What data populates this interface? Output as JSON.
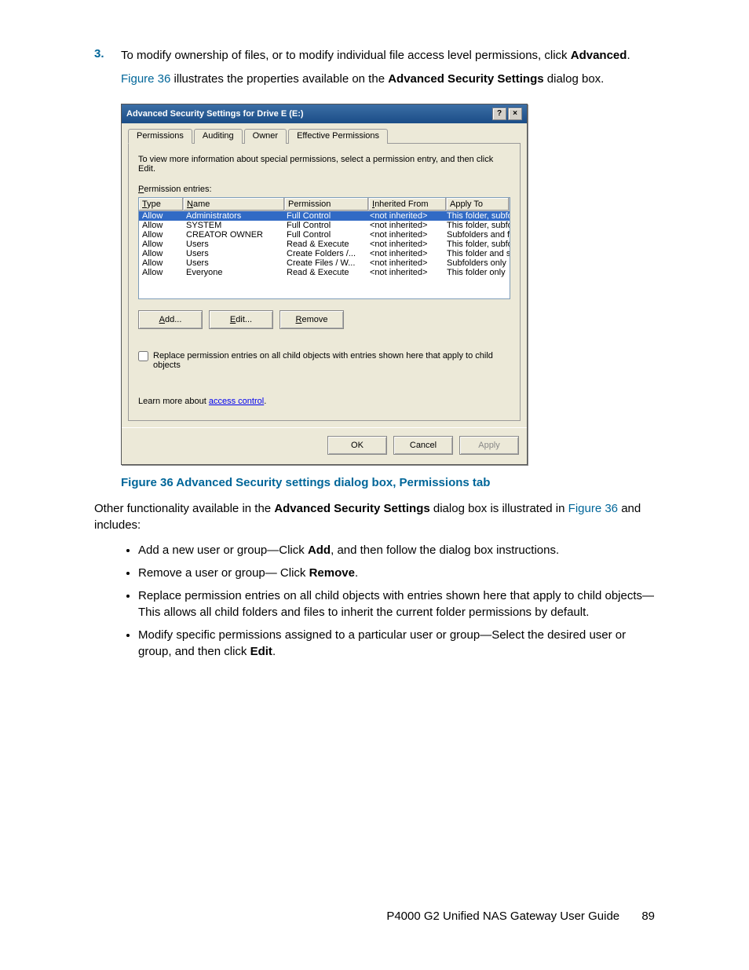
{
  "list_item": {
    "number": "3.",
    "line1_pre": "To modify ownership of files, or to modify individual file access level permissions, click ",
    "line1_bold": "Advanced",
    "line1_post": ".",
    "line2_link": "Figure 36",
    "line2_mid": " illustrates the properties available on the ",
    "line2_bold": "Advanced Security Settings",
    "line2_post": " dialog box."
  },
  "dialog": {
    "title": "Advanced Security Settings for Drive E (E:)",
    "tabs": [
      "Permissions",
      "Auditing",
      "Owner",
      "Effective Permissions"
    ],
    "intro": "To view more information about special permissions, select a permission entry, and then click Edit.",
    "entries_label_u": "P",
    "entries_label_rest": "ermission entries:",
    "columns": {
      "type_u": "T",
      "type_r": "ype",
      "name_u": "N",
      "name_r": "ame",
      "perm": "Permission",
      "inh_u": "I",
      "inh_r": "nherited From",
      "app": "Apply To"
    },
    "rows": [
      {
        "type": "Allow",
        "name": "Administrators",
        "perm": "Full Control",
        "inh": "<not inherited>",
        "app": "This folder, subfolders...",
        "selected": true
      },
      {
        "type": "Allow",
        "name": "SYSTEM",
        "perm": "Full Control",
        "inh": "<not inherited>",
        "app": "This folder, subfolders..."
      },
      {
        "type": "Allow",
        "name": "CREATOR OWNER",
        "perm": "Full Control",
        "inh": "<not inherited>",
        "app": "Subfolders and files only"
      },
      {
        "type": "Allow",
        "name": "Users",
        "perm": "Read & Execute",
        "inh": "<not inherited>",
        "app": "This folder, subfolders..."
      },
      {
        "type": "Allow",
        "name": "Users",
        "perm": "Create Folders /...",
        "inh": "<not inherited>",
        "app": "This folder and subfol..."
      },
      {
        "type": "Allow",
        "name": "Users",
        "perm": "Create Files / W...",
        "inh": "<not inherited>",
        "app": "Subfolders only"
      },
      {
        "type": "Allow",
        "name": "Everyone",
        "perm": "Read & Execute",
        "inh": "<not inherited>",
        "app": "This folder only"
      }
    ],
    "buttons": {
      "add_u": "A",
      "add_r": "dd...",
      "edit_u": "E",
      "edit_r": "dit...",
      "remove_u": "R",
      "remove_r": "emove"
    },
    "checkbox": "Replace permission entries on all child objects with entries shown here that apply to child objects",
    "learn_pre": "Learn more about ",
    "learn_link": "access control",
    "learn_post": ".",
    "footer": {
      "ok": "OK",
      "cancel": "Cancel",
      "apply": "Apply"
    }
  },
  "figure_caption": "Figure 36 Advanced Security settings dialog box, Permissions tab",
  "after": {
    "para_pre": "Other functionality available in the ",
    "para_bold": "Advanced Security Settings",
    "para_mid": " dialog box is illustrated in ",
    "para_link": "Figure 36",
    "para_post": " and includes:",
    "bullets": [
      {
        "pre": "Add a new user or group—Click ",
        "bold": "Add",
        "post": ", and then follow the dialog box instructions."
      },
      {
        "pre": "Remove a user or group— Click ",
        "bold": "Remove",
        "post": "."
      },
      {
        "pre": "Replace permission entries on all child objects with entries shown here that apply to child objects—This allows all child folders and files to inherit the current folder permissions by default.",
        "bold": "",
        "post": ""
      },
      {
        "pre": "Modify specific permissions assigned to a particular user or group—Select the desired user or group, and then click ",
        "bold": "Edit",
        "post": "."
      }
    ]
  },
  "footer": {
    "title": "P4000 G2 Unified NAS Gateway User Guide",
    "page": "89"
  }
}
